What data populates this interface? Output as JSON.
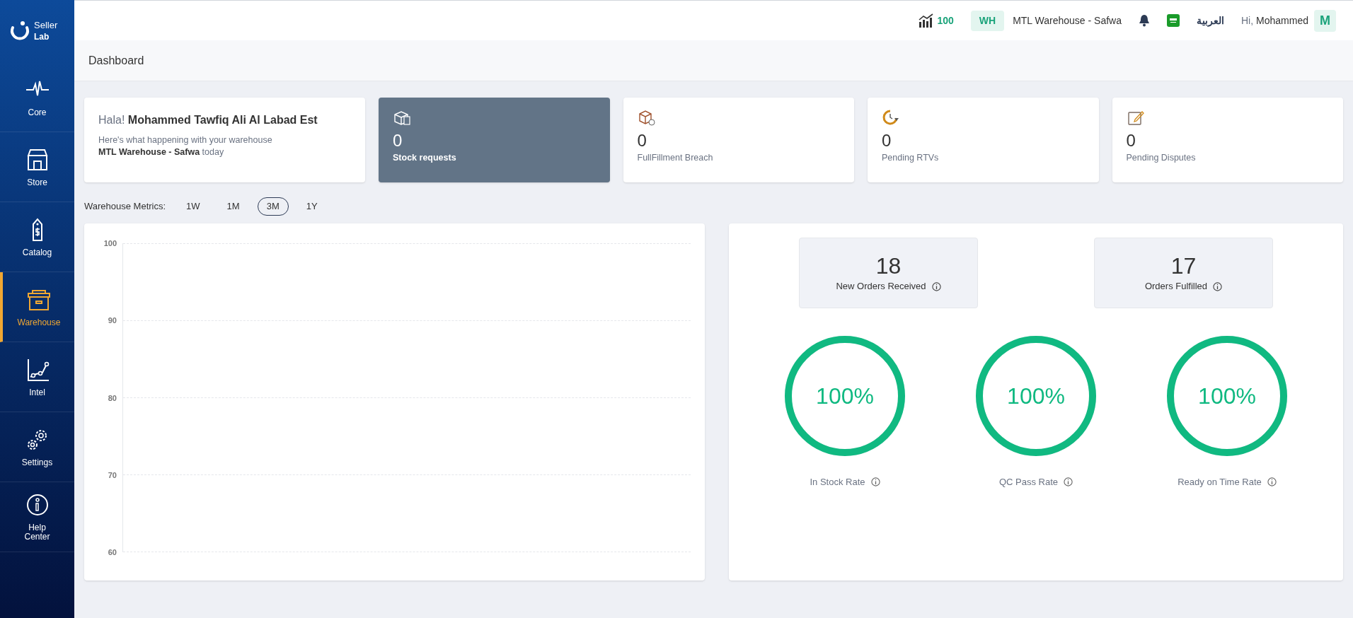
{
  "sidebar": {
    "logo": {
      "line1": "Seller",
      "line2": "Lab"
    },
    "items": [
      {
        "kind": "core",
        "label": "Core",
        "selected": false
      },
      {
        "kind": "store",
        "label": "Store",
        "selected": false
      },
      {
        "kind": "catalog",
        "label": "Catalog",
        "selected": false
      },
      {
        "kind": "warehouse",
        "label": "Warehouse",
        "selected": true
      },
      {
        "kind": "intel",
        "label": "Intel",
        "selected": false
      },
      {
        "kind": "settings",
        "label": "Settings",
        "selected": false
      },
      {
        "kind": "help",
        "label": "Help Center",
        "selected": false
      }
    ]
  },
  "topbar": {
    "score": "100",
    "warehouse_badge": "WH",
    "warehouse": "MTL Warehouse - Safwa",
    "language": "العربية",
    "greeting": "Hi,",
    "user": "Mohammed",
    "avatar": "M"
  },
  "page_title": "Dashboard",
  "welcome": {
    "title": "Hala! **Mohammed Tawfiq Ali Al Labad Est**",
    "text": "Here's what happening with your warehouse **MTL Warehouse - Safwa** today"
  },
  "stat_cards": [
    {
      "kind": "stock",
      "value": "0",
      "label": "Stock requests",
      "selected": true
    },
    {
      "kind": "breach",
      "value": "0",
      "label": "FullFillment Breach",
      "selected": false
    },
    {
      "kind": "rtv",
      "value": "0",
      "label": "Pending RTVs",
      "selected": false
    },
    {
      "kind": "dispute",
      "value": "0",
      "label": "Pending Disputes",
      "selected": false
    }
  ],
  "metrics": {
    "label": "Warehouse Metrics:",
    "periods": [
      {
        "label": "1W",
        "selected": false
      },
      {
        "label": "1M",
        "selected": false
      },
      {
        "label": "3M",
        "selected": true
      },
      {
        "label": "1Y",
        "selected": false
      }
    ]
  },
  "chart": {
    "y_axis_labels": [
      "100",
      "90",
      "80",
      "70",
      "60"
    ]
  },
  "counts": [
    {
      "value": "18",
      "label": "New Orders Received"
    },
    {
      "value": "17",
      "label": "Orders Fulfilled"
    }
  ],
  "rates": [
    {
      "reading": "100%",
      "label": "In Stock Rate",
      "level": 1
    },
    {
      "reading": "100%",
      "label": "QC Pass Rate",
      "level": 1
    },
    {
      "reading": "100%",
      "label": "Ready on Time Rate",
      "level": 1
    }
  ]
}
